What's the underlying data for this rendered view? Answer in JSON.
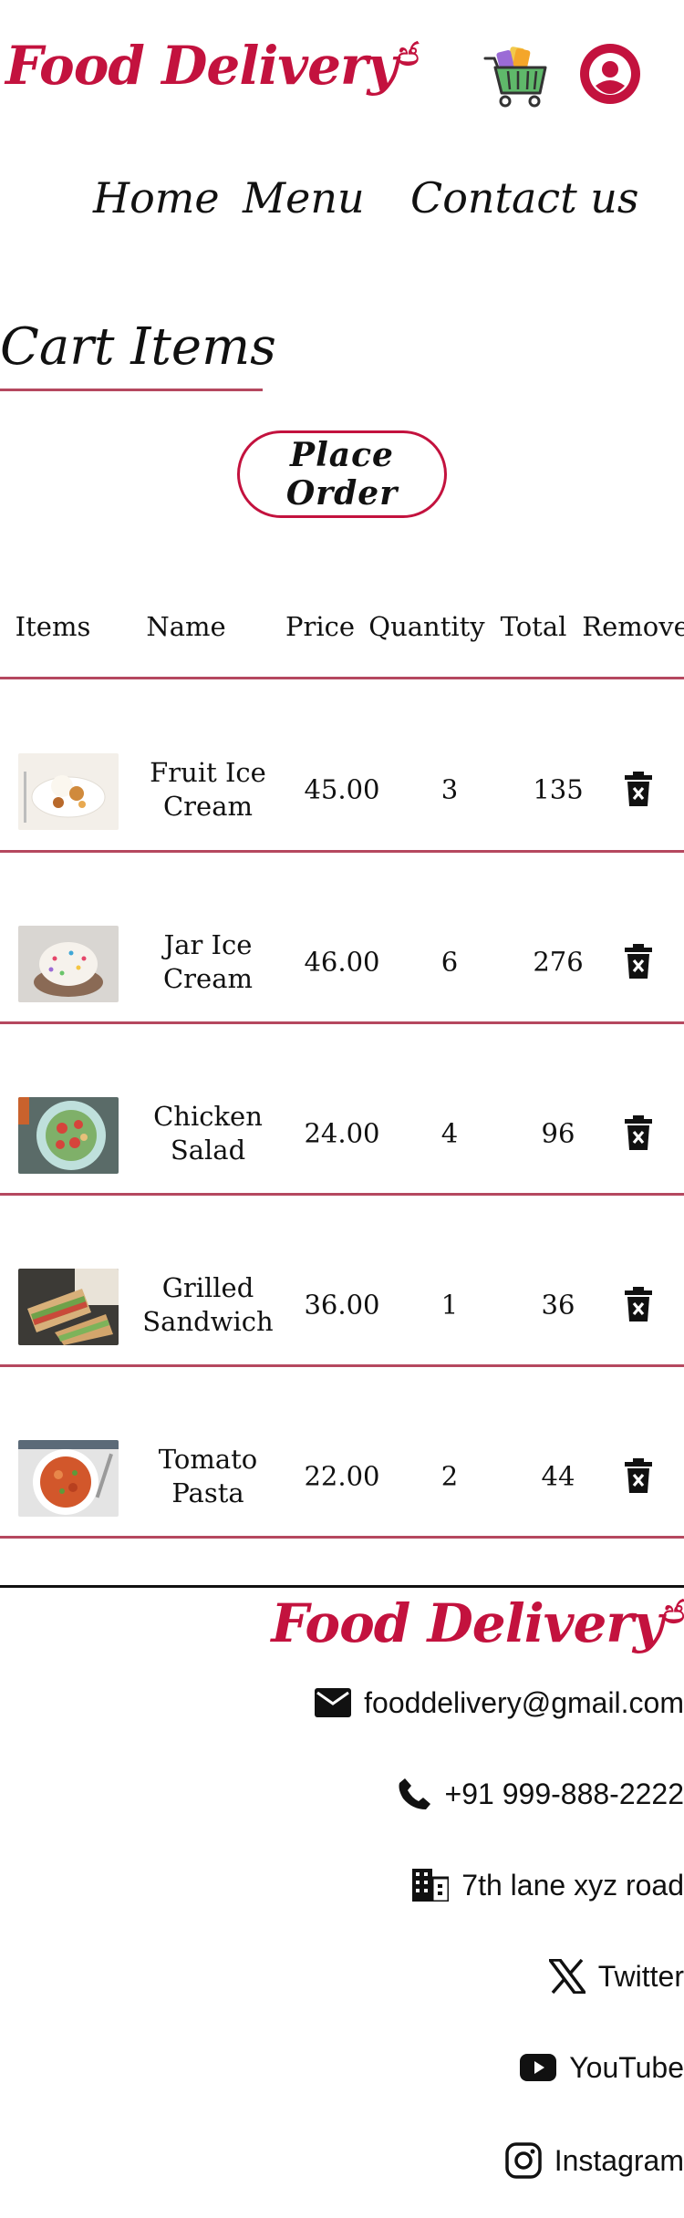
{
  "header": {
    "brand": "Food Delivery",
    "brand_icon": "ජ",
    "cart_icon": "shopping-basket-icon",
    "account_icon": "account-circle-icon"
  },
  "nav": {
    "home": "Home",
    "menu": "Menu",
    "contact": "Contact us"
  },
  "cart": {
    "title": "Cart Items",
    "place_order": "Place Order",
    "columns": [
      "Items",
      "Name",
      "Price",
      "Quantity",
      "Total",
      "Remove"
    ],
    "rows": [
      {
        "name": "Fruit Ice Cream",
        "price": "45.00",
        "quantity": "3",
        "total": "135",
        "image": "fruit-ice-cream-image"
      },
      {
        "name": "Jar Ice Cream",
        "price": "46.00",
        "quantity": "6",
        "total": "276",
        "image": "jar-ice-cream-image"
      },
      {
        "name": "Chicken Salad",
        "price": "24.00",
        "quantity": "4",
        "total": "96",
        "image": "chicken-salad-image"
      },
      {
        "name": "Grilled Sandwich",
        "price": "36.00",
        "quantity": "1",
        "total": "36",
        "image": "grilled-sandwich-image"
      },
      {
        "name": "Tomato Pasta",
        "price": "22.00",
        "quantity": "2",
        "total": "44",
        "image": "tomato-pasta-image"
      }
    ]
  },
  "footer": {
    "brand": "Food Delivery",
    "brand_icon": "ජ",
    "email": "fooddelivery@gmail.com",
    "phone": "+91 999-888-2222",
    "address": "7th lane xyz road",
    "twitter": "Twitter",
    "youtube": "YouTube",
    "instagram": "Instagram"
  },
  "colors": {
    "brand": "#c3123e",
    "divider": "#b5485f"
  }
}
